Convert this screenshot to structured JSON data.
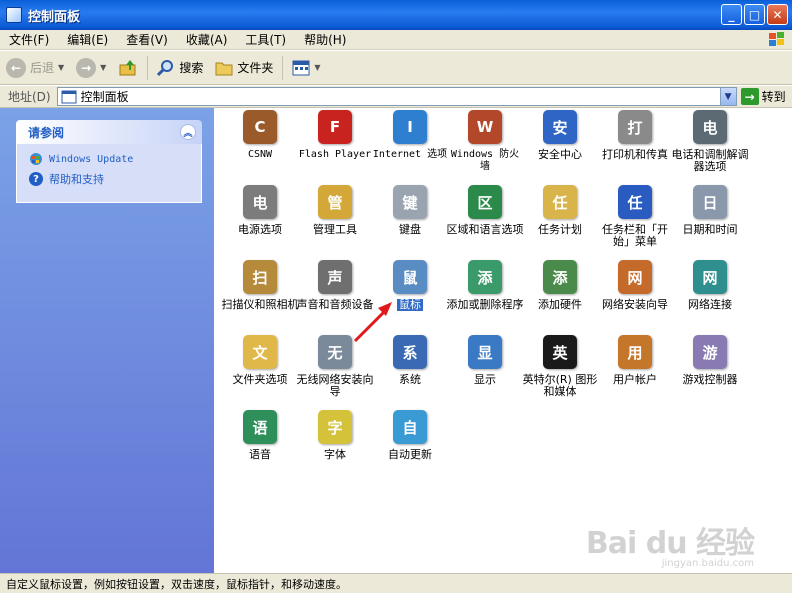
{
  "window": {
    "title": "控制面板"
  },
  "menu": [
    "文件(F)",
    "编辑(E)",
    "查看(V)",
    "收藏(A)",
    "工具(T)",
    "帮助(H)"
  ],
  "toolbar": {
    "back": "后退",
    "search": "搜索",
    "folders": "文件夹"
  },
  "address": {
    "label": "地址(D)",
    "value": "控制面板",
    "go": "转到"
  },
  "see_also": {
    "title": "请参阅",
    "links": [
      "Windows Update",
      "帮助和支持"
    ]
  },
  "items": [
    {
      "label": "CSNW",
      "icon": "csnw-icon",
      "color": "#9a5a2a"
    },
    {
      "label": "Flash Player",
      "icon": "flash-icon",
      "color": "#c8231e"
    },
    {
      "label": "Internet 选项",
      "icon": "internet-options-icon",
      "color": "#2f7fd0"
    },
    {
      "label": "Windows 防火墙",
      "icon": "firewall-icon",
      "color": "#b3472a"
    },
    {
      "label": "安全中心",
      "icon": "security-center-icon",
      "color": "#2f65c4"
    },
    {
      "label": "打印机和传真",
      "icon": "printer-icon",
      "color": "#8a8a8a"
    },
    {
      "label": "电话和调制解调器选项",
      "icon": "phone-modem-icon",
      "color": "#5c6a74"
    },
    {
      "label": "电源选项",
      "icon": "power-icon",
      "color": "#7c7c7c"
    },
    {
      "label": "管理工具",
      "icon": "admin-tools-icon",
      "color": "#d4a838"
    },
    {
      "label": "键盘",
      "icon": "keyboard-icon",
      "color": "#9aa4b0"
    },
    {
      "label": "区域和语言选项",
      "icon": "regional-icon",
      "color": "#2b8a4a"
    },
    {
      "label": "任务计划",
      "icon": "scheduled-tasks-icon",
      "color": "#d9b44a"
    },
    {
      "label": "任务栏和「开始」菜单",
      "icon": "taskbar-icon",
      "color": "#2a5bc1"
    },
    {
      "label": "日期和时间",
      "icon": "clock-icon",
      "color": "#8a98ab"
    },
    {
      "label": "扫描仪和照相机",
      "icon": "scanner-icon",
      "color": "#b58a3a"
    },
    {
      "label": "声音和音频设备",
      "icon": "speaker-icon",
      "color": "#6f6f6f"
    },
    {
      "label": "鼠标",
      "icon": "mouse-icon",
      "color": "#5a8cc4"
    },
    {
      "label": "添加或删除程序",
      "icon": "add-remove-icon",
      "color": "#3a9a6a"
    },
    {
      "label": "添加硬件",
      "icon": "add-hardware-icon",
      "color": "#4a8a4a"
    },
    {
      "label": "网络安装向导",
      "icon": "network-wizard-icon",
      "color": "#c46a2a"
    },
    {
      "label": "网络连接",
      "icon": "network-connections-icon",
      "color": "#2f8f8f"
    },
    {
      "label": "文件夹选项",
      "icon": "folder-options-icon",
      "color": "#e0b84a"
    },
    {
      "label": "无线网络安装向导",
      "icon": "wireless-icon",
      "color": "#7a8a9a"
    },
    {
      "label": "系统",
      "icon": "system-icon",
      "color": "#3a6ab4"
    },
    {
      "label": "显示",
      "icon": "display-icon",
      "color": "#3a7ac4"
    },
    {
      "label": "英特尔(R) 图形和媒体",
      "icon": "intel-graphics-icon",
      "color": "#1a1a1a"
    },
    {
      "label": "用户帐户",
      "icon": "user-accounts-icon",
      "color": "#c4762a"
    },
    {
      "label": "游戏控制器",
      "icon": "game-controller-icon",
      "color": "#8a7ab4"
    },
    {
      "label": "语音",
      "icon": "speech-icon",
      "color": "#2f8f5a"
    },
    {
      "label": "字体",
      "icon": "fonts-icon",
      "color": "#d4c23a"
    },
    {
      "label": "自动更新",
      "icon": "automatic-updates-icon",
      "color": "#3a9ad4"
    }
  ],
  "selected_item": "鼠标",
  "status": "自定义鼠标设置，例如按钮设置，双击速度，鼠标指针，和移动速度。",
  "watermark": {
    "brand": "Bai du 经验",
    "url": "jingyan.baidu.com"
  }
}
